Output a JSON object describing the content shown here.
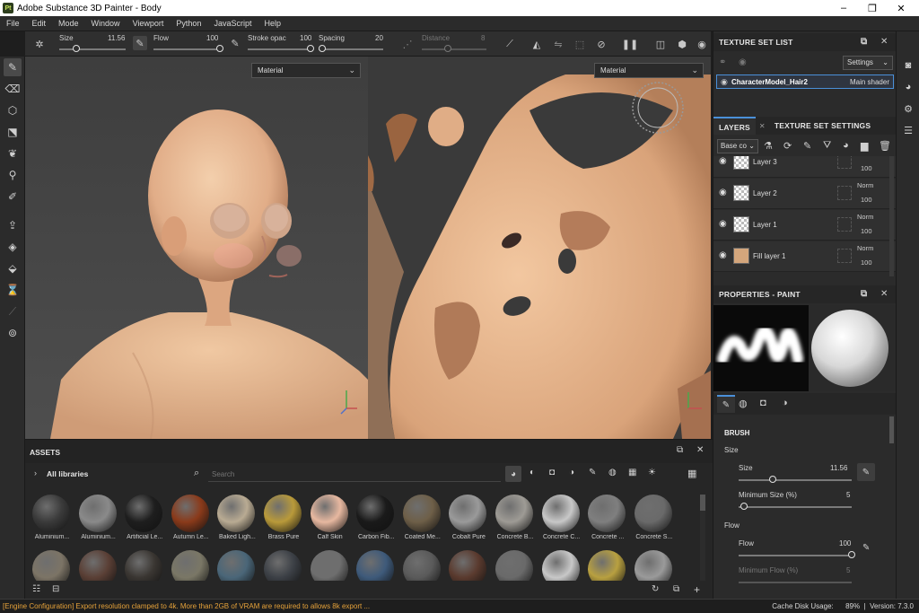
{
  "window": {
    "app_icon": "Pt",
    "title": "Adobe Substance 3D Painter - Body",
    "minimize": "–",
    "maximize": "❐",
    "close": "✕"
  },
  "menu": [
    "File",
    "Edit",
    "Mode",
    "Window",
    "Viewport",
    "Python",
    "JavaScript",
    "Help"
  ],
  "toolbar": {
    "size_label": "Size",
    "size_value": "11.56",
    "size_fraction": 0.25,
    "flow_label": "Flow",
    "flow_value": "100",
    "flow_fraction": 1.0,
    "stroke_label": "Stroke opac",
    "stroke_value": "100",
    "stroke_fraction": 1.0,
    "spacing_label": "Spacing",
    "spacing_value": "20",
    "spacing_fraction": 0.05,
    "distance_label": "Distance",
    "distance_value": "8",
    "distance_fraction": 0.4
  },
  "viewports": {
    "left_mode": "Material",
    "right_mode": "Material"
  },
  "texture_set_list": {
    "title": "TEXTURE SET LIST",
    "settings_label": "Settings",
    "set_name": "CharacterModel_Hair2",
    "shader": "Main shader"
  },
  "layers": {
    "tab_layers": "LAYERS",
    "tab_tss": "TEXTURE SET SETTINGS",
    "channel": "Base co",
    "items": [
      {
        "name": "Layer 3",
        "blend": "",
        "opacity": "100",
        "fill": false
      },
      {
        "name": "Layer 2",
        "blend": "Norm",
        "opacity": "100",
        "fill": false
      },
      {
        "name": "Layer 1",
        "blend": "Norm",
        "opacity": "100",
        "fill": false
      },
      {
        "name": "Fill layer 1",
        "blend": "Norm",
        "opacity": "100",
        "fill": true
      }
    ]
  },
  "properties": {
    "title": "PROPERTIES - PAINT",
    "brush_title": "BRUSH",
    "size_section": "Size",
    "size_label": "Size",
    "size_value": "11.56",
    "size_fraction": 0.3,
    "min_size_label": "Minimum Size (%)",
    "min_size_value": "5",
    "min_size_fraction": 0.05,
    "flow_section": "Flow",
    "flow_label": "Flow",
    "flow_value": "100",
    "flow_fraction": 1.0,
    "min_flow_label": "Minimum Flow (%)",
    "min_flow_value": "5"
  },
  "assets": {
    "title": "ASSETS",
    "libraries": "All libraries",
    "search_placeholder": "Search",
    "materials_row1": [
      {
        "name": "Aluminium...",
        "color": "#3a3a3a"
      },
      {
        "name": "Aluminium...",
        "color": "#8a8a8a"
      },
      {
        "name": "Artificial Le...",
        "color": "#1e1e1e"
      },
      {
        "name": "Autumn Le...",
        "color": "#8a3a1a"
      },
      {
        "name": "Baked Ligh...",
        "color": "#b9ab93"
      },
      {
        "name": "Brass Pure",
        "color": "#b99a3a"
      },
      {
        "name": "Calf Skin",
        "color": "#e7b8a0"
      },
      {
        "name": "Carbon Fib...",
        "color": "#1a1a1a"
      },
      {
        "name": "Coated Me...",
        "color": "#6e5f48"
      },
      {
        "name": "Cobalt Pure",
        "color": "#9a9a9a"
      },
      {
        "name": "Concrete B...",
        "color": "#9e9b95"
      },
      {
        "name": "Concrete C...",
        "color": "#c8c8c8"
      },
      {
        "name": "Concrete ...",
        "color": "#7f7f7f"
      },
      {
        "name": "Concrete S...",
        "color": "#6a6a6a"
      }
    ],
    "materials_row2": [
      "#7c7466",
      "#5a3f35",
      "#3a3632",
      "#7a7766",
      "#4a6678",
      "#3c4046",
      "#6e6e6e",
      "#3e5a7a",
      "#5a5a5a",
      "#5a3a2e",
      "#6a6a6a",
      "#c8c8c8",
      "#b8a040",
      "#9a9a9a"
    ]
  },
  "status": {
    "message": "[Engine Configuration] Export resolution clamped to 4k. More than 2GB of VRAM are required to allows 8k export ...",
    "cache": "Cache Disk Usage:",
    "cache_value": "89%",
    "version": "Version: 7.3.0"
  }
}
